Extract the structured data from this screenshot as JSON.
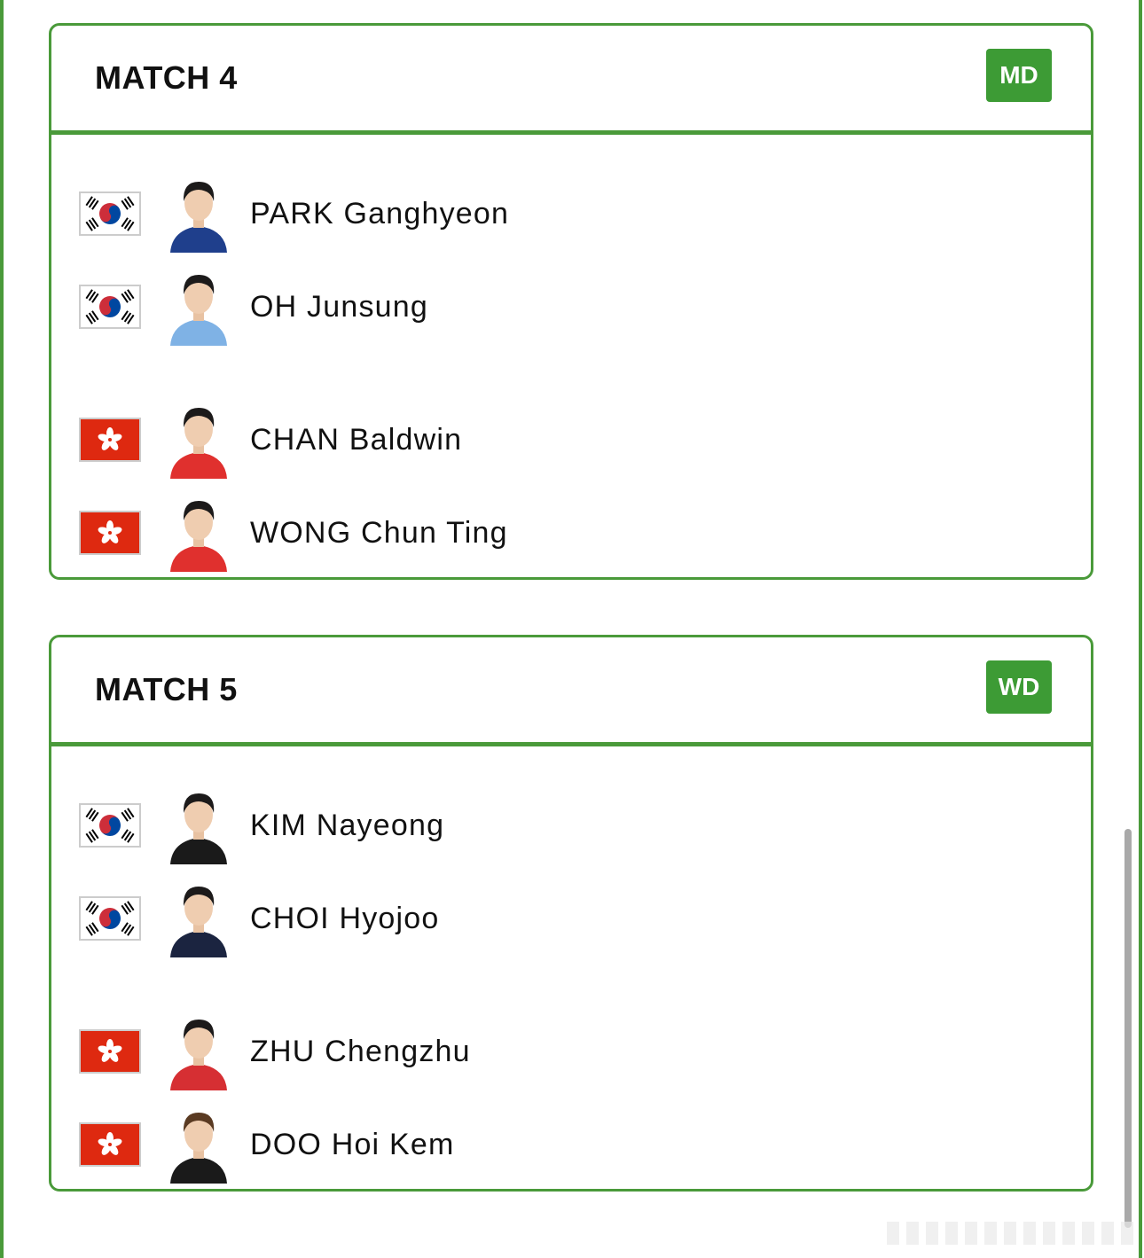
{
  "matches": [
    {
      "title": "MATCH 4",
      "badge": "MD",
      "players": [
        {
          "name": "PARK Ganghyeon",
          "country": "kor",
          "flag_icon": "south-korea-flag-icon",
          "shirt": "#1f3f8c",
          "hair": "#1c1a1a"
        },
        {
          "name": "OH Junsung",
          "country": "kor",
          "flag_icon": "south-korea-flag-icon",
          "shirt": "#7fb2e5",
          "hair": "#1c1a1a"
        },
        {
          "name": "CHAN Baldwin",
          "country": "hkg",
          "flag_icon": "hong-kong-flag-icon",
          "shirt": "#e0302e",
          "hair": "#1c1a1a"
        },
        {
          "name": "WONG Chun Ting",
          "country": "hkg",
          "flag_icon": "hong-kong-flag-icon",
          "shirt": "#e0302e",
          "hair": "#1c1a1a"
        }
      ]
    },
    {
      "title": "MATCH 5",
      "badge": "WD",
      "players": [
        {
          "name": "KIM Nayeong",
          "country": "kor",
          "flag_icon": "south-korea-flag-icon",
          "shirt": "#1a1a1a",
          "hair": "#1c1a1a"
        },
        {
          "name": "CHOI Hyojoo",
          "country": "kor",
          "flag_icon": "south-korea-flag-icon",
          "shirt": "#1b2440",
          "hair": "#1c1a1a"
        },
        {
          "name": "ZHU Chengzhu",
          "country": "hkg",
          "flag_icon": "hong-kong-flag-icon",
          "shirt": "#d62f33",
          "hair": "#1c1a1a"
        },
        {
          "name": "DOO Hoi Kem",
          "country": "hkg",
          "flag_icon": "hong-kong-flag-icon",
          "shirt": "#1a1a1a",
          "hair": "#5a3a22"
        }
      ]
    }
  ],
  "colors": {
    "accent_green": "#4a9a3a",
    "badge_green": "#3d9b35",
    "hk_red": "#de2910",
    "kr_red": "#cd2e3a",
    "kr_blue": "#0047a0"
  }
}
